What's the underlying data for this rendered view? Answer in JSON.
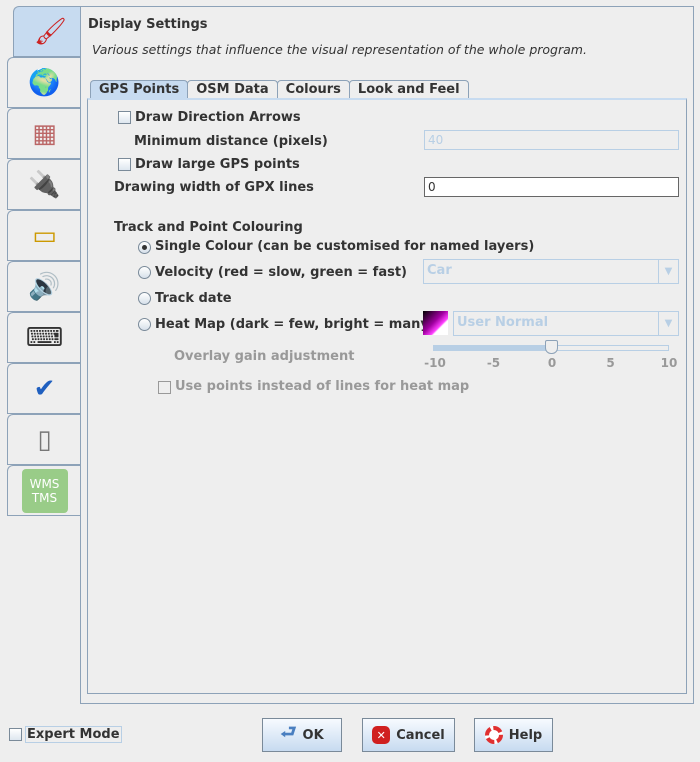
{
  "sidebar": {
    "items": [
      {
        "name": "display-settings",
        "icon": "paint-icon",
        "selected": true
      },
      {
        "name": "connection",
        "icon": "globe-icon"
      },
      {
        "name": "projection",
        "icon": "grid-globe-icon"
      },
      {
        "name": "plugins",
        "icon": "plug-icon"
      },
      {
        "name": "toolbar",
        "icon": "toolbar-icon"
      },
      {
        "name": "audio",
        "icon": "speaker-icon"
      },
      {
        "name": "shortcuts",
        "icon": "keyboard-icon"
      },
      {
        "name": "validator",
        "icon": "checkmark-icon"
      },
      {
        "name": "remote-control",
        "icon": "remote-icon"
      },
      {
        "name": "imagery",
        "icon": "wms-tms-icon",
        "label": "WMS\nTMS"
      }
    ]
  },
  "header": {
    "title": "Display Settings",
    "description": "Various settings that influence the visual representation of the whole program."
  },
  "tabs": [
    {
      "label": "GPS Points",
      "selected": true
    },
    {
      "label": "OSM Data"
    },
    {
      "label": "Colours"
    },
    {
      "label": "Look and Feel"
    }
  ],
  "gps": {
    "draw_arrows": {
      "label": "Draw Direction Arrows",
      "checked": false
    },
    "min_distance": {
      "label": "Minimum distance (pixels)",
      "value": "40"
    },
    "large_points": {
      "label": "Draw large GPS points",
      "checked": false
    },
    "line_width": {
      "label": "Drawing width of GPX lines",
      "value": "0"
    },
    "colouring_title": "Track and Point Colouring",
    "single": "Single Colour (can be customised for named layers)",
    "velocity": "Velocity (red = slow, green = fast)",
    "velocity_combo": "Car",
    "track_date": "Track date",
    "heatmap": "Heat Map (dark = few, bright = many)",
    "heatmap_combo": "User Normal",
    "gain_label": "Overlay gain adjustment",
    "gain_value": 0,
    "gain_ticks": [
      "-10",
      "-5",
      "0",
      "5",
      "10"
    ],
    "use_points": "Use points instead of lines for heat map"
  },
  "footer": {
    "expert": "Expert Mode",
    "ok": "OK",
    "cancel": "Cancel",
    "help": "Help"
  }
}
